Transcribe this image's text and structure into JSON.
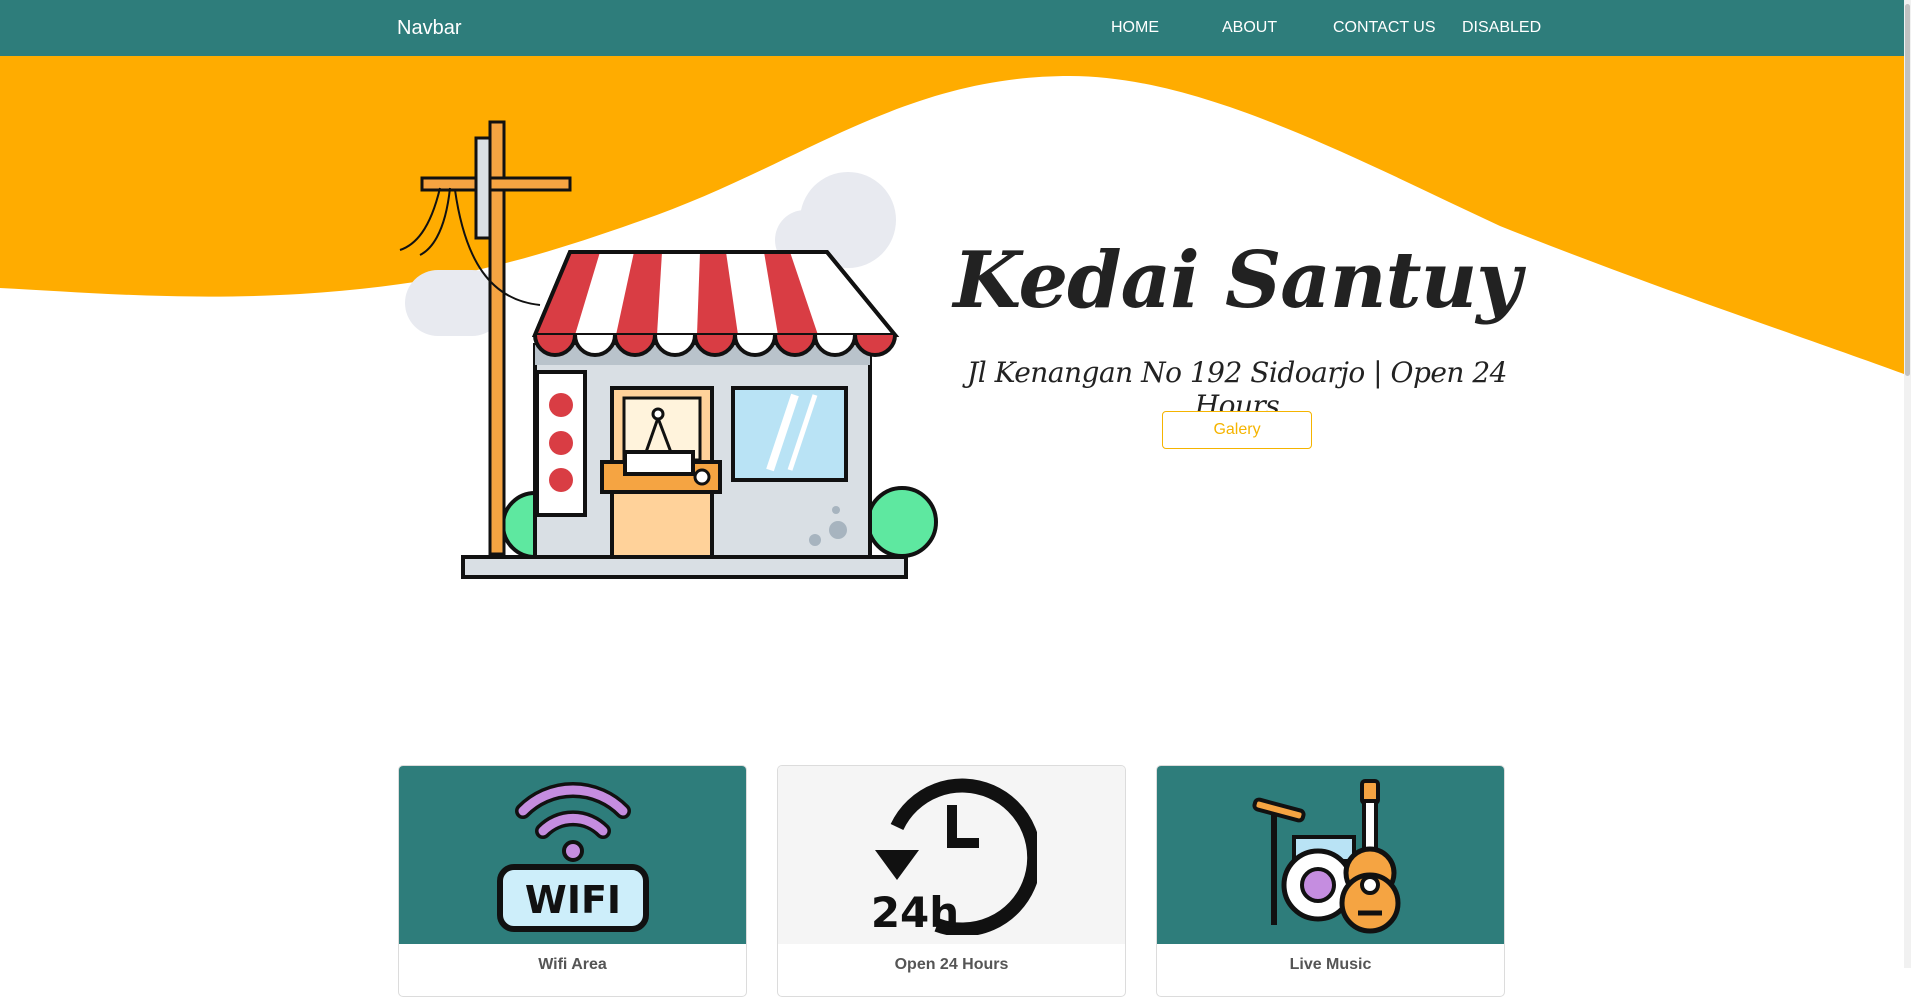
{
  "navbar": {
    "brand": "Navbar",
    "links": [
      {
        "label": "HOME"
      },
      {
        "label": "ABOUT"
      },
      {
        "label": "CONTACT US"
      },
      {
        "label": "DISABLED"
      }
    ]
  },
  "hero": {
    "title": "Kedai Santuy",
    "subtitle": "Jl Kenangan No 192 Sidoarjo | Open 24 Hours",
    "button_label": "Galery",
    "illustration_icon": "shop-icon"
  },
  "cards": [
    {
      "title": "Wifi Area",
      "icon": "wifi-icon",
      "image_text": "WIFI",
      "bg": "#2e7d7b"
    },
    {
      "title": "Open 24 Hours",
      "icon": "clock-24h-icon",
      "image_text": "24h",
      "bg": "#f5f5f5"
    },
    {
      "title": "Live Music",
      "icon": "music-instruments-icon",
      "bg": "#2e7d7b"
    }
  ],
  "colors": {
    "navbar": "#2e7d7b",
    "wave": "#ffac00",
    "accent": "#f5b400",
    "awning_red": "#d93d44",
    "bush_green": "#5ee8a0"
  }
}
